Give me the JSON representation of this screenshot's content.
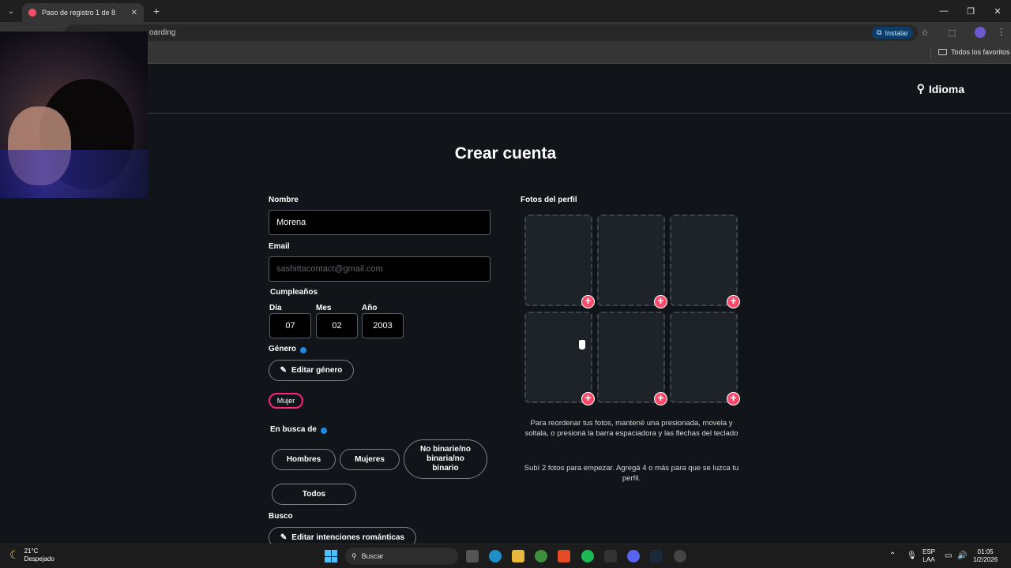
{
  "browser": {
    "tab_title": "Paso de registro 1 de 8",
    "url_visible": "oarding",
    "install_label": "Instalar",
    "all_bookmarks": "Todos los favoritos"
  },
  "header": {
    "language": "Idioma"
  },
  "form": {
    "title": "Crear cuenta",
    "name_label": "Nombre",
    "name_value": "Morena",
    "email_label": "Email",
    "email_value": "sashittacontact@gmail.com",
    "birthday_label": "Cumpleaños",
    "day_label": "Día",
    "month_label": "Mes",
    "year_label": "Año",
    "day_value": "07",
    "month_value": "02",
    "year_value": "2003",
    "gender_label": "Género",
    "edit_gender": "Editar género",
    "selected_gender": "Mujer",
    "seeking_label": "En busca de",
    "seeking_options": [
      "Hombres",
      "Mujeres",
      "No binarie/no binaria/no binario",
      "Todos"
    ],
    "looking_for_label": "Busco",
    "edit_intentions": "Editar intenciones románticas"
  },
  "photos": {
    "label": "Fotos del perfil",
    "reorder_hint": "Para reordenar tus fotos, mantené una presionada, movela y soltala, o presioná la barra espaciadora y las flechas del teclado",
    "upload_hint": "Subí 2 fotos para empezar. Agregá 4 o más para que se luzca tu perfil."
  },
  "taskbar": {
    "temp": "21°C",
    "weather": "Despejado",
    "search": "Buscar",
    "lang_1": "ESP",
    "lang_2": "LAA",
    "time": "01:05",
    "date": "1/2/2026"
  },
  "colors": {
    "accent": "#fd4a6b",
    "selected_border": "#fd267a",
    "background": "#111418"
  }
}
